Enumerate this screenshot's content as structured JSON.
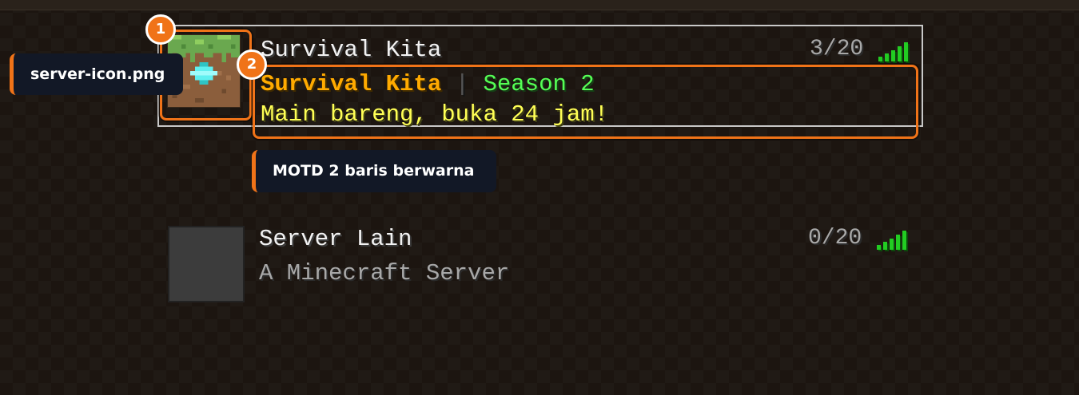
{
  "servers": [
    {
      "name": "Survival Kita",
      "players": "3/20",
      "icon": "grass-block-diamond-icon",
      "selected": true,
      "motd": {
        "line1": {
          "part1": "Survival Kita",
          "separator": "|",
          "part2": "Season 2"
        },
        "line2": "Main bareng, buka 24 jam!"
      }
    },
    {
      "name": "Server Lain",
      "players": "0/20",
      "icon": "default-server-icon",
      "selected": false,
      "motd": {
        "line1": "A Minecraft Server"
      }
    }
  ],
  "annotations": [
    {
      "number": "1",
      "label": "server-icon.png"
    },
    {
      "number": "2",
      "label": "MOTD 2 baris berwarna"
    }
  ],
  "colors": {
    "accent": "#f07318",
    "motd_gold": "#ffaa00",
    "motd_green": "#55ff55",
    "motd_yellow": "#ffff55",
    "signal": "#22cc22",
    "selection_border": "#c8c8c8"
  }
}
